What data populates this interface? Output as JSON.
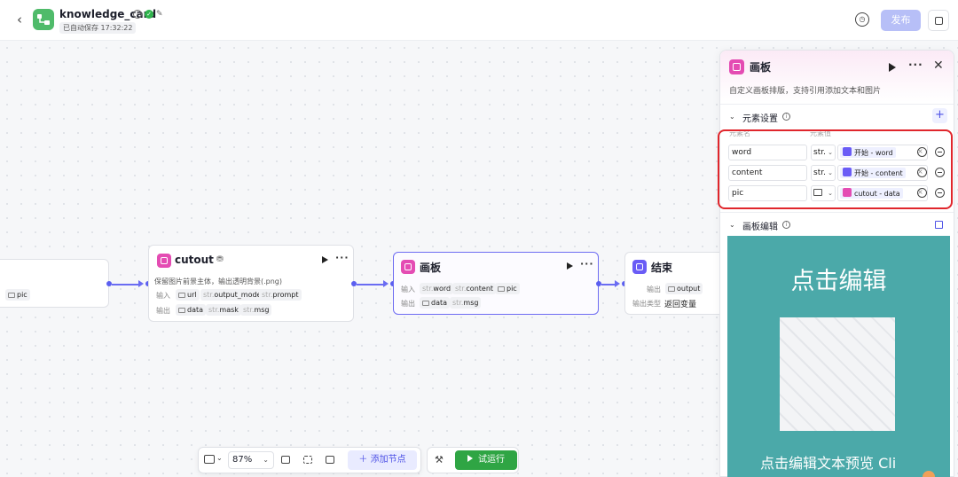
{
  "header": {
    "app_name": "knowledge_card",
    "autosave": "已自动保存 17:32:22",
    "publish_label": "发布",
    "back_glyph": "‹"
  },
  "nodes": {
    "prev": {
      "output_tag": "pic"
    },
    "cutout": {
      "title": "cutout",
      "description": "保留图片前景主体，输出透明背景(.png)",
      "input_label": "输入",
      "output_label": "输出",
      "inputs": [
        {
          "type": "",
          "name": "url",
          "icon": "image-icon"
        },
        {
          "type": "str.",
          "name": "output_mode"
        },
        {
          "type": "str.",
          "name": "prompt"
        }
      ],
      "outputs": [
        {
          "type": "",
          "name": "data",
          "icon": "image-icon"
        },
        {
          "type": "str.",
          "name": "mask"
        },
        {
          "type": "str.",
          "name": "msg"
        }
      ]
    },
    "canvas": {
      "title": "画板",
      "input_label": "输入",
      "output_label": "输出",
      "inputs": [
        {
          "type": "str.",
          "name": "word"
        },
        {
          "type": "str.",
          "name": "content"
        },
        {
          "type": "",
          "name": "pic",
          "icon": "image-icon"
        }
      ],
      "outputs": [
        {
          "type": "",
          "name": "data",
          "icon": "image-icon"
        },
        {
          "type": "str.",
          "name": "msg"
        }
      ]
    },
    "end": {
      "title": "结束",
      "output_label": "输出",
      "output_tag": "output",
      "output_type_label": "输出类型",
      "output_type_value": "返回变量"
    }
  },
  "toolbar": {
    "zoom": "87%",
    "add_node_label": "添加节点",
    "run_label": "试运行"
  },
  "panel": {
    "title": "画板",
    "description": "自定义画板排版，支持引用添加文本和图片",
    "elements_section": "元素设置",
    "col_name": "元素名",
    "col_value": "元素值",
    "elements": [
      {
        "name": "word",
        "type": "str.",
        "ref": "开始 - word",
        "ref_color": "purple"
      },
      {
        "name": "content",
        "type": "str.",
        "ref": "开始 - content",
        "ref_color": "purple"
      },
      {
        "name": "pic",
        "type": "",
        "type_icon": "image-icon",
        "ref": "cutout - data",
        "ref_color": "pink"
      }
    ],
    "editor_section": "画板编辑",
    "preview_title": "点击编辑",
    "preview_subtitle": "点击编辑文本预览 Cli"
  },
  "colors": {
    "accent": "#5b5ff0",
    "run_green": "#2fa544",
    "highlight_red": "#e0262c",
    "preview_bg": "#4ba9a9",
    "canvas_node_pink": "#e44cb3",
    "start_node_purple": "#6a5cf6"
  }
}
